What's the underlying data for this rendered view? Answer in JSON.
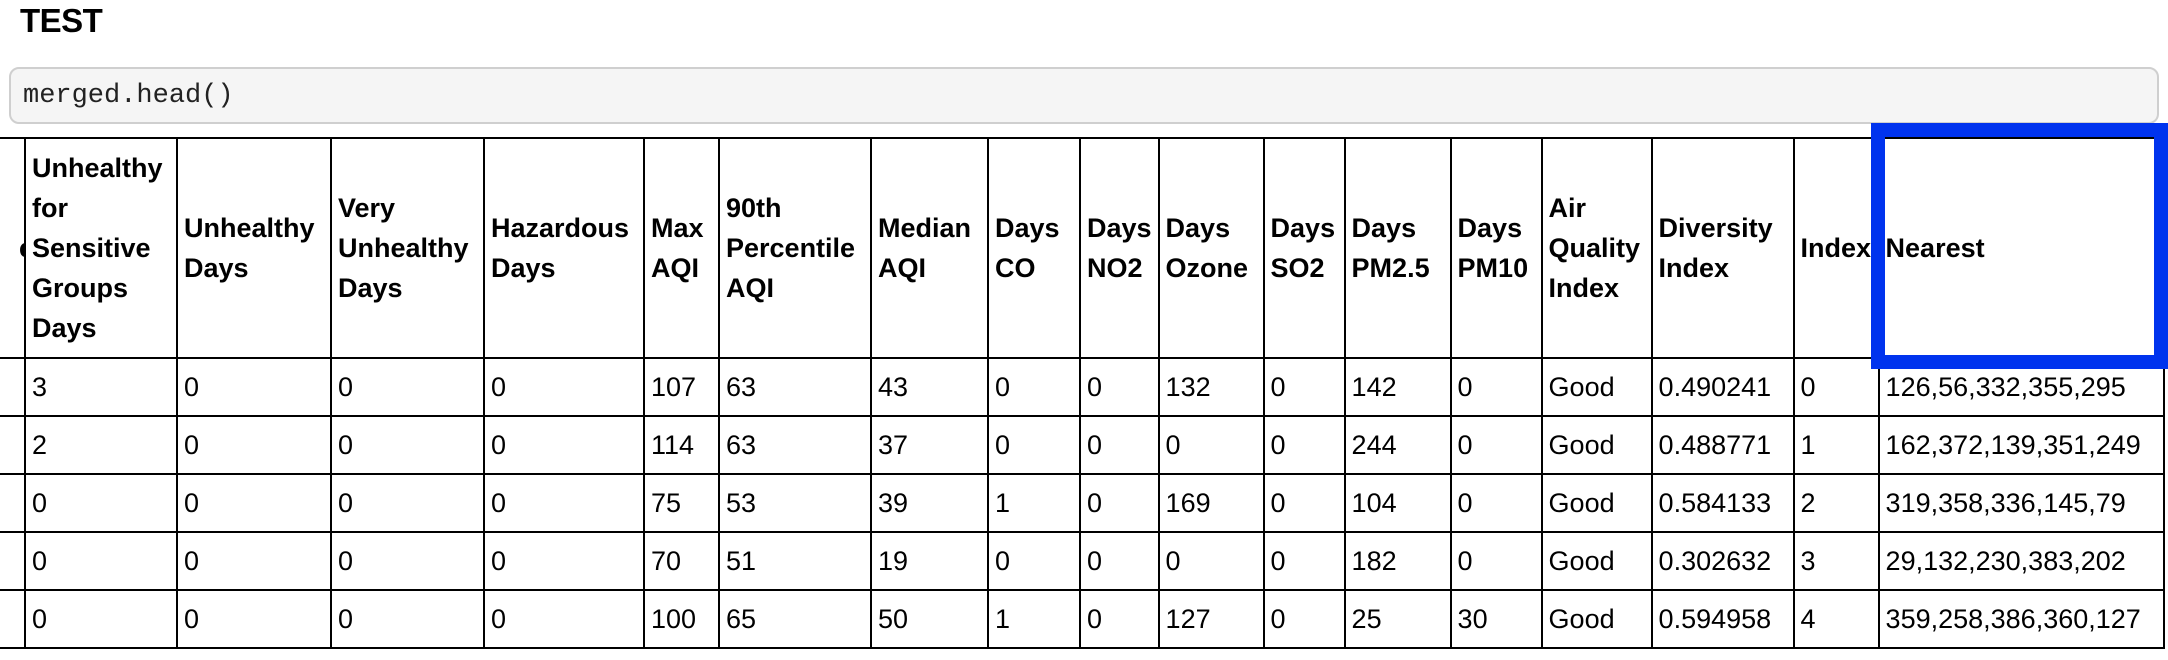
{
  "heading": "TEST",
  "code_cell": {
    "source": "merged.head()"
  },
  "table": {
    "truncated_left_header": "e",
    "columns": [
      "Unhealthy for Sensitive Groups Days",
      "Unhealthy Days",
      "Very Unhealthy Days",
      "Hazardous Days",
      "Max AQI",
      "90th Percentile AQI",
      "Median AQI",
      "Days CO",
      "Days NO2",
      "Days Ozone",
      "Days SO2",
      "Days PM2.5",
      "Days PM10",
      "Air Quality Index",
      "Diversity Index",
      "Index",
      "Nearest"
    ],
    "rows": [
      [
        "3",
        "0",
        "0",
        "0",
        "107",
        "63",
        "43",
        "0",
        "0",
        "132",
        "0",
        "142",
        "0",
        "Good",
        "0.490241",
        "0",
        "126,56,332,355,295"
      ],
      [
        "2",
        "0",
        "0",
        "0",
        "114",
        "63",
        "37",
        "0",
        "0",
        "0",
        "0",
        "244",
        "0",
        "Good",
        "0.488771",
        "1",
        "162,372,139,351,249"
      ],
      [
        "0",
        "0",
        "0",
        "0",
        "75",
        "53",
        "39",
        "1",
        "0",
        "169",
        "0",
        "104",
        "0",
        "Good",
        "0.584133",
        "2",
        "319,358,336,145,79"
      ],
      [
        "0",
        "0",
        "0",
        "0",
        "70",
        "51",
        "19",
        "0",
        "0",
        "0",
        "0",
        "182",
        "0",
        "Good",
        "0.302632",
        "3",
        "29,132,230,383,202"
      ],
      [
        "0",
        "0",
        "0",
        "0",
        "100",
        "65",
        "50",
        "1",
        "0",
        "127",
        "0",
        "25",
        "30",
        "Good",
        "0.594958",
        "4",
        "359,258,386,360,127"
      ]
    ],
    "highlighted_column": "Nearest"
  },
  "colors": {
    "highlight": "#0033ee",
    "code_bg": "#f5f5f5",
    "code_border": "#cfcfcf"
  }
}
